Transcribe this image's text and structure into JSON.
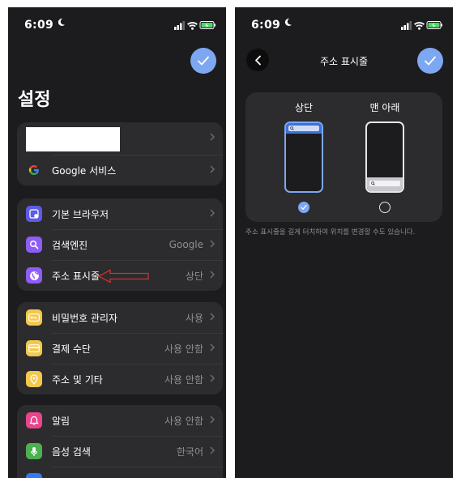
{
  "status": {
    "time": "6:09"
  },
  "settings": {
    "title": "설정",
    "account": {
      "google_services": "Google 서비스"
    },
    "group_browser": [
      {
        "label": "기본 브라우저",
        "value": "",
        "icon": "browser-icon",
        "color": "#5e5ce6"
      },
      {
        "label": "검색엔진",
        "value": "Google",
        "icon": "search-icon",
        "color": "#8e5cf7"
      },
      {
        "label": "주소 표시줄",
        "value": "상단",
        "icon": "globe-icon",
        "color": "#8e5cf7"
      }
    ],
    "group_autofill": [
      {
        "label": "비밀번호 관리자",
        "value": "사용",
        "icon": "key-icon",
        "color": "#f2c94c"
      },
      {
        "label": "결제 수단",
        "value": "사용 안함",
        "icon": "card-icon",
        "color": "#f2c94c"
      },
      {
        "label": "주소 및 기타",
        "value": "사용 안함",
        "icon": "location-icon",
        "color": "#f2c94c"
      }
    ],
    "group_misc": [
      {
        "label": "알림",
        "value": "사용 안함",
        "icon": "bell-icon",
        "color": "#e8458b"
      },
      {
        "label": "음성 검색",
        "value": "한국어",
        "icon": "mic-icon",
        "color": "#4cb050"
      }
    ]
  },
  "address_bar": {
    "title": "주소 표시줄",
    "options": [
      {
        "label": "상단",
        "selected": true
      },
      {
        "label": "맨 아래",
        "selected": false
      }
    ],
    "hint": "주소 표시줄을 길게 터치하여 위치를 변경할 수도 있습니다."
  },
  "colors": {
    "accent": "#7ea7f1",
    "background": "#1c1c1e",
    "card": "#2c2c2e",
    "annotation": "#d32f2f"
  }
}
